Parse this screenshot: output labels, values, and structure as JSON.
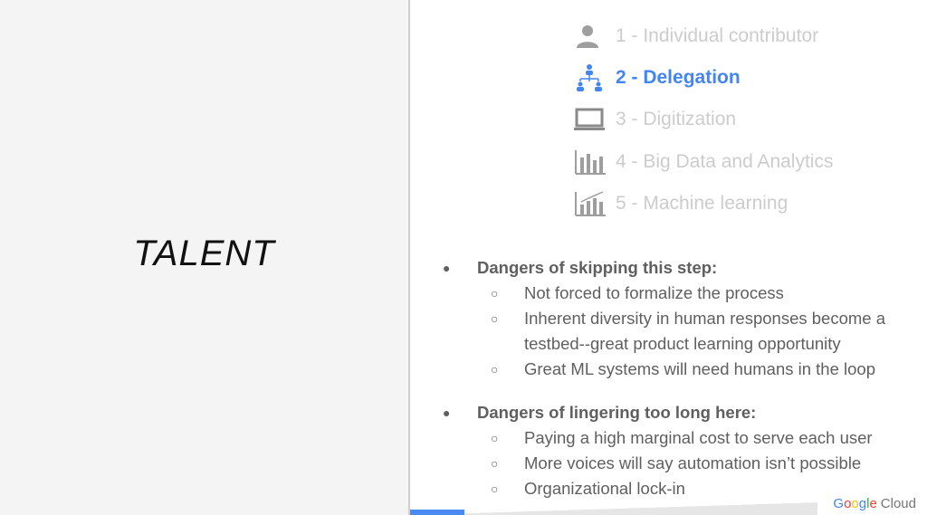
{
  "left": {
    "title": "TALENT"
  },
  "steps": [
    {
      "label": "1 - Individual contributor",
      "icon": "person-icon",
      "active": false
    },
    {
      "label": "2 - Delegation",
      "icon": "org-chart-icon",
      "active": true
    },
    {
      "label": "3 - Digitization",
      "icon": "laptop-icon",
      "active": false
    },
    {
      "label": "4 - Big Data and Analytics",
      "icon": "bar-chart-icon",
      "active": false
    },
    {
      "label": "5 - Machine learning",
      "icon": "trend-chart-icon",
      "active": false
    }
  ],
  "sections": [
    {
      "heading": "Dangers of skipping this step:",
      "items": [
        "Not forced to formalize the process",
        "Inherent diversity in human responses become a testbed--great product learning opportunity",
        "Great ML systems will need humans in the loop"
      ]
    },
    {
      "heading": "Dangers of lingering too long here:",
      "items": [
        "Paying a high marginal cost to serve each user",
        "More voices will say automation isn’t possible",
        "Organizational lock-in"
      ]
    }
  ],
  "logo": {
    "google": "Google",
    "cloud": "Cloud"
  },
  "colors": {
    "active": "#4285f4",
    "inactive": "#cccccc",
    "bullet_text": "#5f5f5f"
  }
}
